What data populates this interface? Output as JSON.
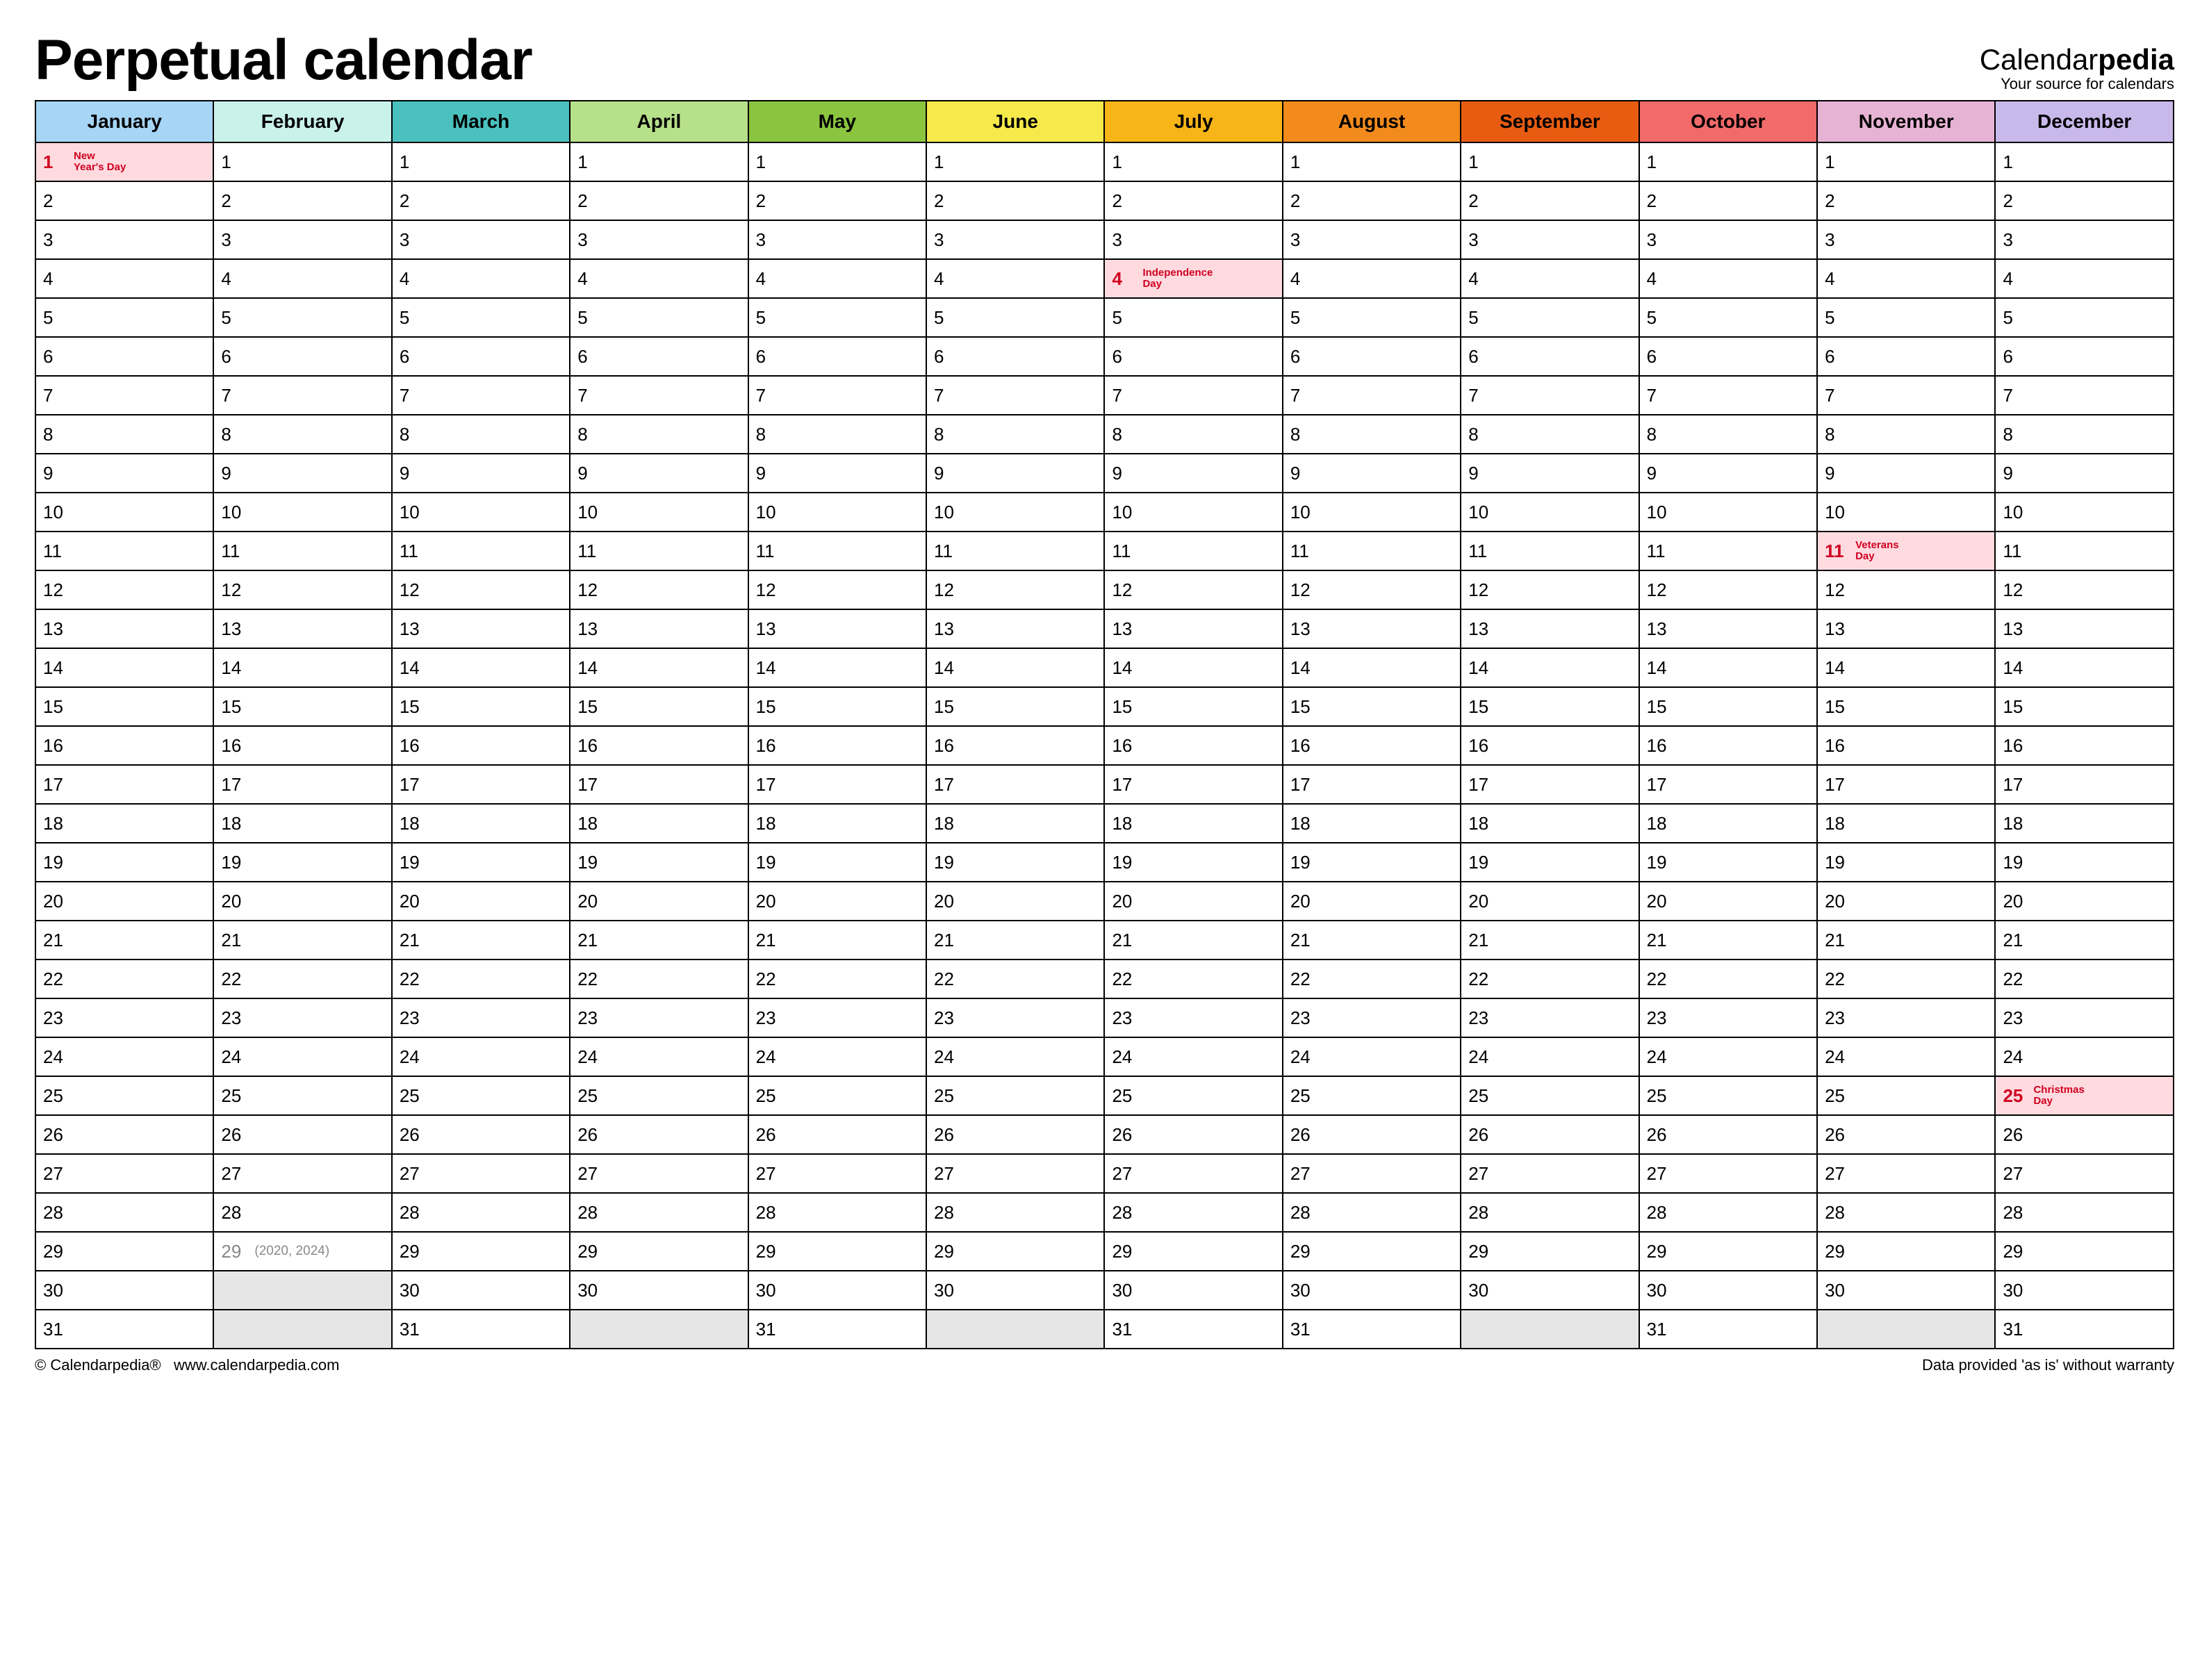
{
  "title": "Perpetual calendar",
  "brand": {
    "left": "Calendar",
    "bold": "pedia",
    "tag": "Your source for calendars"
  },
  "months": [
    {
      "name": "January",
      "days": 31,
      "color": "#a6d5f5"
    },
    {
      "name": "February",
      "days": 29,
      "color": "#c9f2ea"
    },
    {
      "name": "March",
      "days": 31,
      "color": "#4ac1bf"
    },
    {
      "name": "April",
      "days": 30,
      "color": "#b7e08a"
    },
    {
      "name": "May",
      "days": 31,
      "color": "#8bc53f"
    },
    {
      "name": "June",
      "days": 30,
      "color": "#f5ea4a"
    },
    {
      "name": "July",
      "days": 31,
      "color": "#f8b518"
    },
    {
      "name": "August",
      "days": 31,
      "color": "#f28b1c"
    },
    {
      "name": "September",
      "days": 30,
      "color": "#e85c12"
    },
    {
      "name": "October",
      "days": 31,
      "color": "#f26a6a"
    },
    {
      "name": "November",
      "days": 30,
      "color": "#e7b3d4"
    },
    {
      "name": "December",
      "days": 31,
      "color": "#c9b8ea"
    }
  ],
  "max_days": 31,
  "holidays": [
    {
      "month": 0,
      "day": 1,
      "label": "New Year's Day"
    },
    {
      "month": 6,
      "day": 4,
      "label": "Independence Day"
    },
    {
      "month": 10,
      "day": 11,
      "label": "Veterans Day"
    },
    {
      "month": 11,
      "day": 25,
      "label": "Christmas Day"
    }
  ],
  "leap_note": {
    "month": 1,
    "day": 29,
    "text": "(2020, 2024)"
  },
  "footer": {
    "left_copyright": "© Calendarpedia®",
    "left_url": "www.calendarpedia.com",
    "right": "Data provided 'as is' without warranty"
  }
}
